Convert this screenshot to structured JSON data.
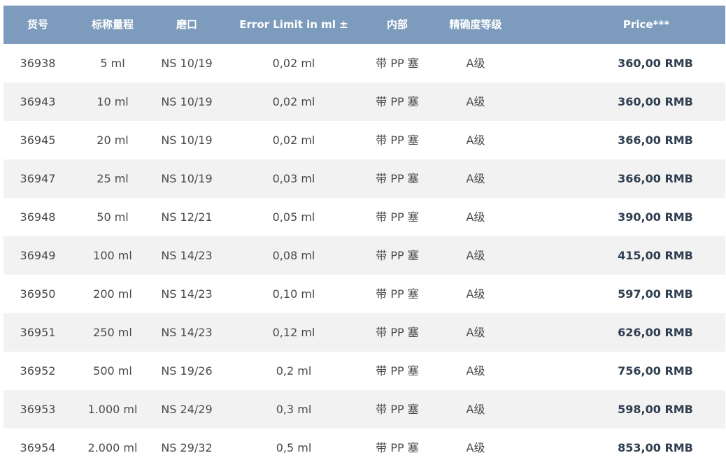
{
  "table": {
    "headers": {
      "sku": "货号",
      "nominal_capacity": "标称量程",
      "ground_joint": "磨口",
      "error_limit": "Error Limit in ml ±",
      "interior": "内部",
      "accuracy_class": "精确度等级",
      "price": "Price***"
    },
    "rows": [
      {
        "sku": "36938",
        "capacity": "5 ml",
        "joint": "NS 10/19",
        "error": "0,02 ml",
        "interior": "带 PP 塞",
        "class": "A级",
        "price": "360,00 RMB"
      },
      {
        "sku": "36943",
        "capacity": "10 ml",
        "joint": "NS 10/19",
        "error": "0,02 ml",
        "interior": "带 PP 塞",
        "class": "A级",
        "price": "360,00 RMB"
      },
      {
        "sku": "36945",
        "capacity": "20 ml",
        "joint": "NS 10/19",
        "error": "0,02 ml",
        "interior": "带 PP 塞",
        "class": "A级",
        "price": "366,00 RMB"
      },
      {
        "sku": "36947",
        "capacity": "25 ml",
        "joint": "NS 10/19",
        "error": "0,03 ml",
        "interior": "带 PP 塞",
        "class": "A级",
        "price": "366,00 RMB"
      },
      {
        "sku": "36948",
        "capacity": "50 ml",
        "joint": "NS 12/21",
        "error": "0,05 ml",
        "interior": "带 PP 塞",
        "class": "A级",
        "price": "390,00 RMB"
      },
      {
        "sku": "36949",
        "capacity": "100 ml",
        "joint": "NS 14/23",
        "error": "0,08 ml",
        "interior": "带 PP 塞",
        "class": "A级",
        "price": "415,00 RMB"
      },
      {
        "sku": "36950",
        "capacity": "200 ml",
        "joint": "NS 14/23",
        "error": "0,10 ml",
        "interior": "带 PP 塞",
        "class": "A级",
        "price": "597,00 RMB"
      },
      {
        "sku": "36951",
        "capacity": "250 ml",
        "joint": "NS 14/23",
        "error": "0,12 ml",
        "interior": "带 PP 塞",
        "class": "A级",
        "price": "626,00 RMB"
      },
      {
        "sku": "36952",
        "capacity": "500 ml",
        "joint": "NS 19/26",
        "error": "0,2 ml",
        "interior": "带 PP 塞",
        "class": "A级",
        "price": "756,00 RMB"
      },
      {
        "sku": "36953",
        "capacity": "1.000 ml",
        "joint": "NS 24/29",
        "error": "0,3 ml",
        "interior": "带 PP 塞",
        "class": "A级",
        "price": "598,00 RMB"
      },
      {
        "sku": "36954",
        "capacity": "2.000 ml",
        "joint": "NS 29/32",
        "error": "0,5 ml",
        "interior": "带 PP 塞",
        "class": "A级",
        "price": "853,00 RMB"
      }
    ]
  },
  "colors": {
    "header_bg": "#7d9cbd",
    "header_text": "#ffffff",
    "stripe_bg": "#f2f2f2",
    "body_text": "#4a4a4a",
    "price_text": "#2f3e50"
  }
}
